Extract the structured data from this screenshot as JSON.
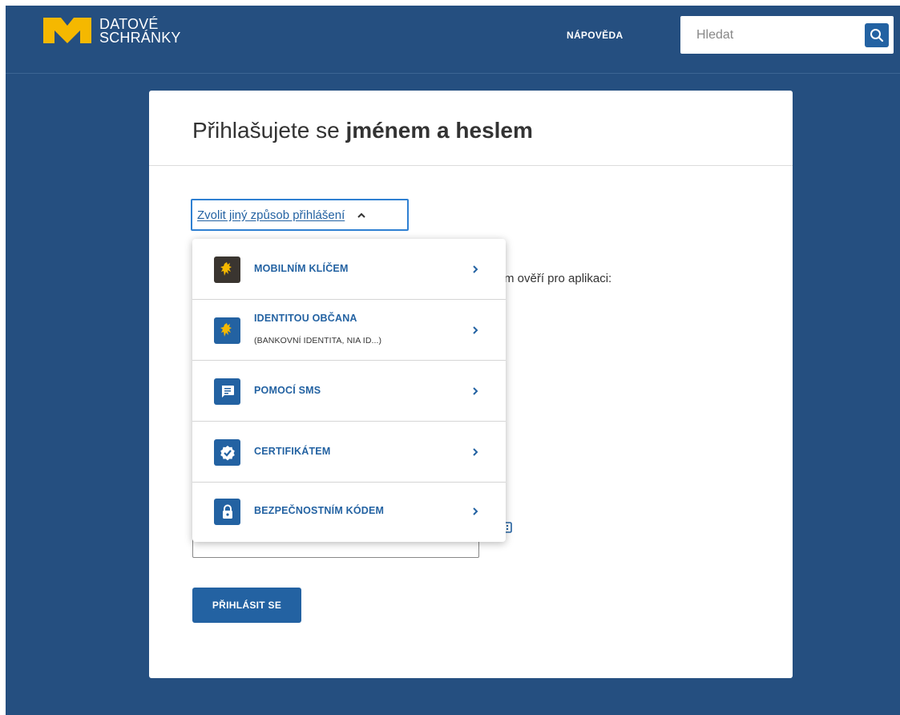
{
  "header": {
    "logo_line1": "DATOVÉ",
    "logo_line2": "SCHRÁNKY",
    "help_link": "NÁPOVĚDA",
    "search_placeholder": "Hledat"
  },
  "card": {
    "title_prefix": "Přihlašujete se ",
    "title_bold": "jménem a heslem",
    "method_toggle": "Zvolit jiný způsob přihlášení",
    "background_text": "m ověří pro aplikaci:",
    "login_button": "PŘIHLÁSIT SE"
  },
  "dropdown": {
    "items": [
      {
        "label": "MOBILNÍM KLÍČEM",
        "icon": "lion-emblem-icon"
      },
      {
        "label": "IDENTITOU OBČANA",
        "sublabel": "(BANKOVNÍ IDENTITA, NIA ID...)",
        "icon": "lion-emblem-icon"
      },
      {
        "label": "POMOCÍ SMS",
        "icon": "message-icon"
      },
      {
        "label": "CERTIFIKÁTEM",
        "icon": "verified-badge-icon"
      },
      {
        "label": "BEZPEČNOSTNÍM KÓDEM",
        "icon": "lock-icon"
      }
    ]
  },
  "colors": {
    "background": "#254f80",
    "accent": "#2362a2",
    "logo": "#f5b800",
    "focus_border": "#2f80d2"
  }
}
